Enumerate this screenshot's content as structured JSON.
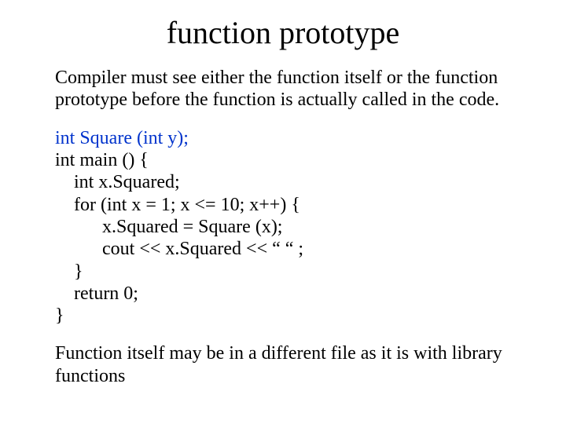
{
  "title": "function prototype",
  "intro": "Compiler must see either the function itself or the function prototype before the function is actually called in the code.",
  "code": {
    "proto": "int Square (int y);",
    "l1": "int main () {",
    "l2": "    int x.Squared;",
    "l3": "    for (int x = 1; x <= 10; x++) {",
    "l4": "          x.Squared = Square (x);",
    "l5": "          cout << x.Squared << “ “ ;",
    "l6": "    }",
    "l7": "    return 0;",
    "l8": "}"
  },
  "footnote": "Function itself may be in a different file as it is with library functions"
}
